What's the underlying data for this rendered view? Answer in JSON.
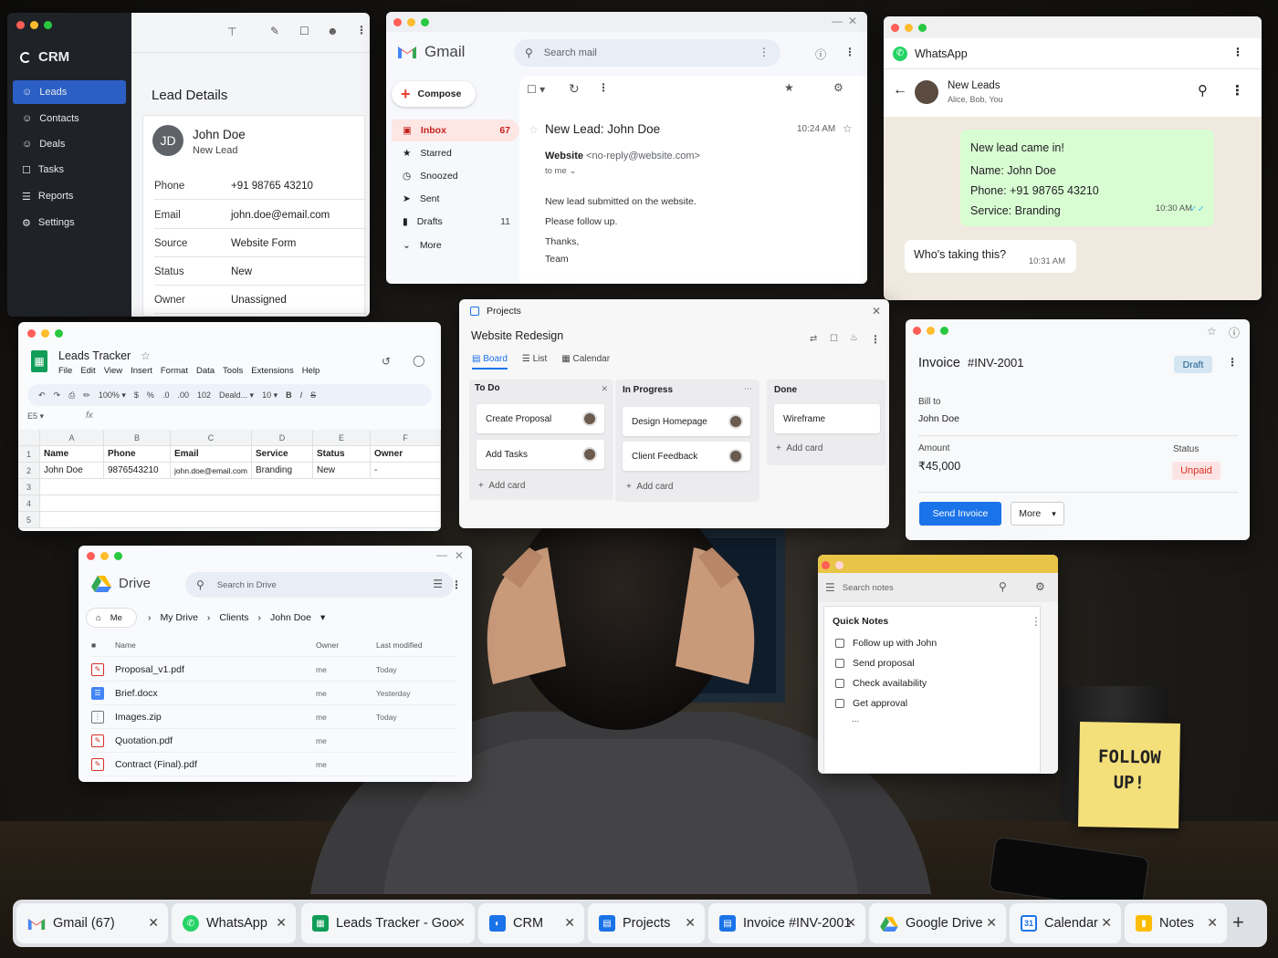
{
  "crm": {
    "brand": "CRM",
    "nav": [
      "Leads",
      "Contacts",
      "Deals",
      "Tasks",
      "Reports",
      "Settings"
    ],
    "heading": "Lead Details",
    "avatar_initials": "JD",
    "name": "John Doe",
    "subtitle": "New Lead",
    "fields": [
      {
        "k": "Phone",
        "v": "+91 98765 43210"
      },
      {
        "k": "Email",
        "v": "john.doe@email.com"
      },
      {
        "k": "Source",
        "v": "Website Form"
      },
      {
        "k": "Status",
        "v": "New"
      },
      {
        "k": "Owner",
        "v": "Unassigned"
      }
    ]
  },
  "gmail": {
    "brand": "Gmail",
    "search_placeholder": "Search mail",
    "compose": "Compose",
    "menu": [
      {
        "label": "Inbox",
        "count": "67"
      },
      {
        "label": "Starred",
        "count": ""
      },
      {
        "label": "Snoozed",
        "count": ""
      },
      {
        "label": "Sent",
        "count": ""
      },
      {
        "label": "Drafts",
        "count": "11"
      },
      {
        "label": "More",
        "count": ""
      }
    ],
    "subject": "New Lead: John Doe",
    "time": "10:24 AM",
    "sender_name": "Website",
    "sender_email": "<no-reply@website.com>",
    "to": "to me",
    "body": [
      "New lead submitted on the website.",
      "Please follow up.",
      "Thanks,",
      "Team"
    ]
  },
  "whatsapp": {
    "brand": "WhatsApp",
    "chat_name": "New Leads",
    "members": "Alice, Bob, You",
    "msg1": {
      "lines": [
        "New lead came in!",
        "Name: John Doe",
        "Phone: +91 98765 43210",
        "Service: Branding"
      ],
      "time": "10:30 AM"
    },
    "msg2": {
      "text": "Who's taking this?",
      "time": "10:31 AM"
    }
  },
  "sheets": {
    "title": "Leads Tracker",
    "menu": [
      "File",
      "Edit",
      "View",
      "Insert",
      "Format",
      "Data",
      "Tools",
      "Extensions",
      "Help"
    ],
    "toolbar": {
      "zoom": "100%",
      "currency": "$",
      "percent": "%",
      "dec": ".0",
      "dec2": ".00",
      "num": "102",
      "font": "Deald...",
      "size": "10"
    },
    "cell_ref": "E5",
    "fx": "fx",
    "col_letters": [
      "A",
      "B",
      "C",
      "D",
      "E",
      "F"
    ],
    "rows": [
      [
        "Name",
        "Phone",
        "Email",
        "Service",
        "Status",
        "Owner"
      ],
      [
        "John Doe",
        "9876543210",
        "john.doe@email.com",
        "Branding",
        "New",
        "-"
      ],
      [
        "",
        "",
        "",
        "",
        "",
        ""
      ],
      [
        "",
        "",
        "",
        "",
        "",
        ""
      ],
      [
        "",
        "",
        "",
        "",
        "",
        ""
      ]
    ],
    "row_numbers": [
      "1",
      "2",
      "3",
      "4",
      "5"
    ]
  },
  "projects": {
    "app": "Projects",
    "title": "Website Redesign",
    "views": [
      "Board",
      "List",
      "Calendar"
    ],
    "columns": [
      {
        "name": "To Do",
        "cards": [
          "Create Proposal",
          "Add Tasks"
        ]
      },
      {
        "name": "In Progress",
        "cards": [
          "Design Homepage",
          "Client Feedback"
        ]
      },
      {
        "name": "Done",
        "cards": [
          "Wireframe"
        ]
      }
    ],
    "add_card": "Add card"
  },
  "invoice": {
    "title": "Invoice",
    "number": "#INV-2001",
    "badge": "Draft",
    "bill_to_label": "Bill to",
    "bill_to": "John Doe",
    "amount_label": "Amount",
    "amount": "₹45,000",
    "status_label": "Status",
    "status": "Unpaid",
    "send": "Send Invoice",
    "more": "More"
  },
  "drive": {
    "brand": "Drive",
    "search_placeholder": "Search in Drive",
    "me": "Me",
    "breadcrumb": [
      "My Drive",
      "Clients",
      "John Doe"
    ],
    "headers": {
      "name": "Name",
      "owner": "Owner",
      "modified": "Last modified"
    },
    "files": [
      {
        "name": "Proposal_v1.pdf",
        "owner": "me",
        "modified": "Today",
        "icon": "pdf"
      },
      {
        "name": "Brief.docx",
        "owner": "me",
        "modified": "Yesterday",
        "icon": "doc"
      },
      {
        "name": "Images.zip",
        "owner": "me",
        "modified": "Today",
        "icon": "zip"
      },
      {
        "name": "Quotation.pdf",
        "owner": "me",
        "modified": "",
        "icon": "pdf"
      },
      {
        "name": "Contract (Final).pdf",
        "owner": "me",
        "modified": "",
        "icon": "pdf"
      }
    ]
  },
  "notes": {
    "search_placeholder": "Search notes",
    "heading": "Quick Notes",
    "items": [
      "Follow up with John",
      "Send proposal",
      "Check availability",
      "Get approval"
    ],
    "ellipsis": "..."
  },
  "sticky": {
    "line1": "FOLLOW",
    "line2": "UP!"
  },
  "taskbar": {
    "tabs": [
      {
        "label": "Gmail (67)",
        "icon": "gmail"
      },
      {
        "label": "WhatsApp",
        "icon": "whatsapp"
      },
      {
        "label": "Leads Tracker - Goo",
        "icon": "sheets"
      },
      {
        "label": "CRM",
        "icon": "crm"
      },
      {
        "label": "Projects",
        "icon": "projects"
      },
      {
        "label": "Invoice #INV-2001",
        "icon": "invoice"
      },
      {
        "label": "Google Drive",
        "icon": "drive"
      },
      {
        "label": "Calendar",
        "icon": "calendar"
      },
      {
        "label": "Notes",
        "icon": "notes"
      }
    ],
    "calendar_day": "31"
  },
  "colors": {
    "crm_accent": "#2b5fc5",
    "gmail_red": "#c5221f",
    "whatsapp_green": "#25d366",
    "sheets_green": "#0f9d58",
    "invoice_blue": "#1a73e8",
    "unpaid_red": "#d93025"
  }
}
